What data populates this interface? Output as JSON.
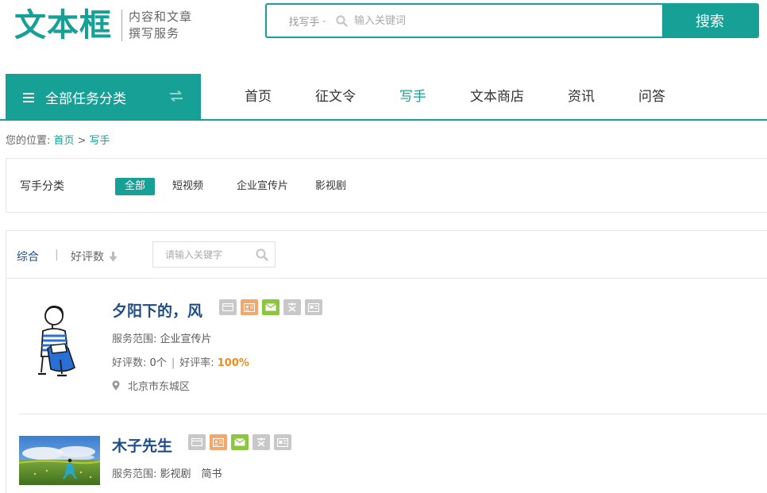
{
  "header": {
    "logo_main": "文本框",
    "logo_sub_line1": "内容和文章",
    "logo_sub_line2": "撰写服务",
    "search_scope": "找写手",
    "search_placeholder": "输入关键词",
    "search_button": "搜索"
  },
  "nav": {
    "category_button": "全部任务分类",
    "items": [
      "首页",
      "征文令",
      "写手",
      "文本商店",
      "资讯",
      "问答"
    ],
    "active": "写手"
  },
  "breadcrumb": {
    "prefix": "您的位置:",
    "home": "首页",
    "separator": ">",
    "current": "写手"
  },
  "filter": {
    "label": "写手分类",
    "options": [
      "全部",
      "短视频",
      "企业宣传片",
      "影视剧"
    ],
    "active": "全部"
  },
  "sort": {
    "all": "综合",
    "divider": "|",
    "rating": "好评数",
    "keyword_placeholder": "请输入关键字"
  },
  "writers": [
    {
      "name": "夕阳下的，风",
      "service_label": "服务范围:",
      "services": "企业宣传片",
      "rating_count_label": "好评数:",
      "rating_count": "0个",
      "rating_rate_label": "好评率:",
      "rating_rate": "100%",
      "location": "北京市东城区",
      "badges": [
        "id-card-icon",
        "profile-card-icon",
        "email-icon",
        "education-icon",
        "certificate-icon"
      ]
    },
    {
      "name": "木子先生",
      "service_label": "服务范围:",
      "services": "影视剧　简书",
      "badges": [
        "id-card-icon",
        "profile-card-icon",
        "email-icon",
        "education-icon",
        "certificate-icon"
      ]
    }
  ],
  "colors": {
    "brand": "#17a096",
    "link_blue": "#1f4d8a",
    "rate_orange": "#f08c1e",
    "badge_gray": "#c8c8c8",
    "badge_orange": "#f5a76a",
    "badge_green": "#8cc63f"
  }
}
